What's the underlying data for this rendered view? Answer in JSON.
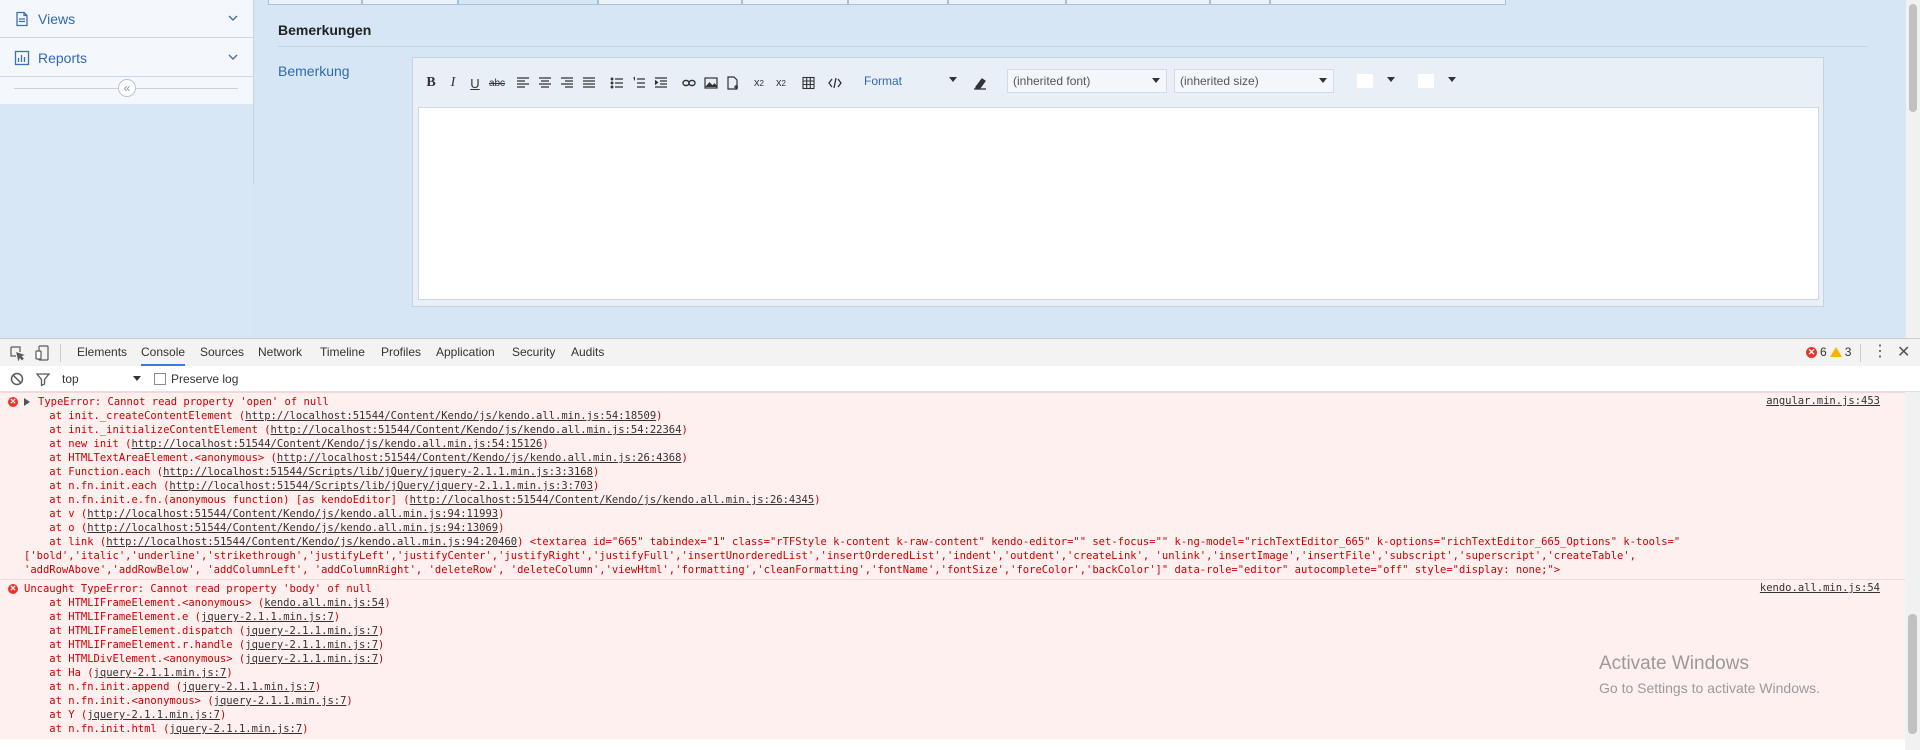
{
  "sidebar": {
    "items": [
      {
        "label": "Views",
        "icon": "document-icon"
      },
      {
        "label": "Reports",
        "icon": "bar-chart-icon"
      }
    ],
    "collapse_glyph": "«"
  },
  "form": {
    "section_title": "Bemerkungen",
    "field_label": "Bemerkung",
    "toolbar": {
      "format": "Format",
      "font": "(inherited font)",
      "size": "(inherited size)"
    }
  },
  "devtools": {
    "tabs": [
      "Elements",
      "Console",
      "Sources",
      "Network",
      "Timeline",
      "Profiles",
      "Application",
      "Security",
      "Audits"
    ],
    "active_tab": "Console",
    "error_count": "6",
    "warning_count": "3",
    "context": "top",
    "preserve_log": "Preserve log",
    "messages": [
      {
        "text": "TypeError: Cannot read property 'open' of null",
        "source": "angular.min.js:453",
        "stack": [
          {
            "pre": "    at init._createContentElement (",
            "url": "http://localhost:51544/Content/Kendo/js/kendo.all.min.js:54:18509",
            "post": ")"
          },
          {
            "pre": "    at init._initializeContentElement (",
            "url": "http://localhost:51544/Content/Kendo/js/kendo.all.min.js:54:22364",
            "post": ")"
          },
          {
            "pre": "    at new init (",
            "url": "http://localhost:51544/Content/Kendo/js/kendo.all.min.js:54:15126",
            "post": ")"
          },
          {
            "pre": "    at HTMLTextAreaElement.<anonymous> (",
            "url": "http://localhost:51544/Content/Kendo/js/kendo.all.min.js:26:4368",
            "post": ")"
          },
          {
            "pre": "    at Function.each (",
            "url": "http://localhost:51544/Scripts/lib/jQuery/jquery-2.1.1.min.js:3:3168",
            "post": ")"
          },
          {
            "pre": "    at n.fn.init.each (",
            "url": "http://localhost:51544/Scripts/lib/jQuery/jquery-2.1.1.min.js:3:703",
            "post": ")"
          },
          {
            "pre": "    at n.fn.init.e.fn.(anonymous function) [as kendoEditor] (",
            "url": "http://localhost:51544/Content/Kendo/js/kendo.all.min.js:26:4345",
            "post": ")"
          },
          {
            "pre": "    at v (",
            "url": "http://localhost:51544/Content/Kendo/js/kendo.all.min.js:94:11993",
            "post": ")"
          },
          {
            "pre": "    at o (",
            "url": "http://localhost:51544/Content/Kendo/js/kendo.all.min.js:94:13069",
            "post": ")"
          },
          {
            "pre": "    at link (",
            "url": "http://localhost:51544/Content/Kendo/js/kendo.all.min.js:94:20460",
            "post": ") <textarea id=\"665\" tabindex=\"1\" class=\"rTFStyle k-content k-raw-content\" kendo-editor=\"\" set-focus=\"\" k-ng-model=\"richTextEditor_665\" k-options=\"richTextEditor_665_Options\" k-tools=\""
          }
        ],
        "wrap": [
          "['bold','italic','underline','strikethrough','justifyLeft','justifyCenter','justifyRight','justifyFull','insertUnorderedList','insertOrderedList','indent','outdent','createLink', 'unlink','insertImage','insertFile','subscript','superscript','createTable',",
          "'addRowAbove','addRowBelow', 'addColumnLeft', 'addColumnRight', 'deleteRow', 'deleteColumn','viewHtml','formatting','cleanFormatting','fontName','fontSize','foreColor','backColor']\" data-role=\"editor\" autocomplete=\"off\" style=\"display: none;\">"
        ]
      },
      {
        "text": "Uncaught TypeError: Cannot read property 'body' of null",
        "source": "kendo.all.min.js:54",
        "stack": [
          {
            "pre": "    at HTMLIFrameElement.<anonymous> (",
            "url": "kendo.all.min.js:54",
            "post": ")"
          },
          {
            "pre": "    at HTMLIFrameElement.e (",
            "url": "jquery-2.1.1.min.js:7",
            "post": ")"
          },
          {
            "pre": "    at HTMLIFrameElement.dispatch (",
            "url": "jquery-2.1.1.min.js:7",
            "post": ")"
          },
          {
            "pre": "    at HTMLIFrameElement.r.handle (",
            "url": "jquery-2.1.1.min.js:7",
            "post": ")"
          },
          {
            "pre": "    at HTMLDivElement.<anonymous> (",
            "url": "jquery-2.1.1.min.js:7",
            "post": ")"
          },
          {
            "pre": "    at Ha (",
            "url": "jquery-2.1.1.min.js:7",
            "post": ")"
          },
          {
            "pre": "    at n.fn.init.append (",
            "url": "jquery-2.1.1.min.js:7",
            "post": ")"
          },
          {
            "pre": "    at n.fn.init.<anonymous> (",
            "url": "jquery-2.1.1.min.js:7",
            "post": ")"
          },
          {
            "pre": "    at Y (",
            "url": "jquery-2.1.1.min.js:7",
            "post": ")"
          },
          {
            "pre": "    at n.fn.init.html (",
            "url": "jquery-2.1.1.min.js:7",
            "post": ")"
          }
        ]
      }
    ]
  },
  "watermark": {
    "title": "Activate Windows",
    "subtitle": "Go to Settings to activate Windows."
  },
  "colors": {
    "accent": "#2f69b3",
    "error": "#e8352b",
    "error_bg": "#fff0f0",
    "warning": "#f4b400"
  }
}
